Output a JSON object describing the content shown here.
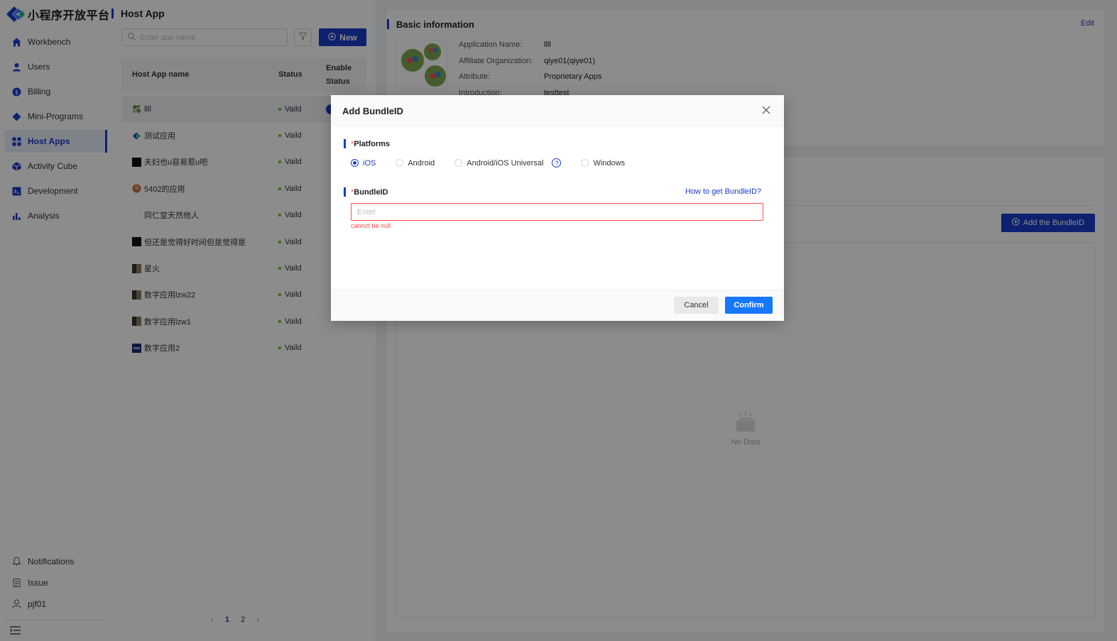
{
  "brand": {
    "name": "小程序开放平台",
    "accent": "#1a3cc9"
  },
  "sidebar": {
    "items": [
      {
        "label": "Workbench",
        "icon": "home-icon"
      },
      {
        "label": "Users",
        "icon": "user-icon"
      },
      {
        "label": "Billing",
        "icon": "billing-icon"
      },
      {
        "label": "Mini-Programs",
        "icon": "diamond-icon"
      },
      {
        "label": "Host Apps",
        "icon": "grid-icon",
        "active": true
      },
      {
        "label": "Activity Cube",
        "icon": "cube-icon"
      },
      {
        "label": "Development",
        "icon": "terminal-icon"
      },
      {
        "label": "Analysis",
        "icon": "bar-chart-icon"
      }
    ],
    "bottom": [
      {
        "label": "Notifications",
        "icon": "bell-icon"
      },
      {
        "label": "Issue",
        "icon": "clipboard-icon"
      },
      {
        "label": "pjf01",
        "icon": "avatar-icon"
      }
    ]
  },
  "list": {
    "title": "Host App",
    "search_placeholder": "Enter app name",
    "new_label": "New",
    "columns": {
      "name": "Host App name",
      "status": "Status",
      "enable_1": "Enable",
      "enable_2": "Status"
    },
    "rows": [
      {
        "name": "llll",
        "status": "Vaild"
      },
      {
        "name": "测试应用",
        "status": "Vaild"
      },
      {
        "name": "夫妇也u容易惹u吧",
        "status": "Vaild"
      },
      {
        "name": "5402的应用",
        "status": "Vaild"
      },
      {
        "name": "同仁堂天然他人",
        "status": "Vaild"
      },
      {
        "name": "但还是觉得好时间但是觉得是",
        "status": "Vaild"
      },
      {
        "name": "星火",
        "status": "Vaild"
      },
      {
        "name": "数字应用lzw22",
        "status": "Vaild"
      },
      {
        "name": "数字应用lzw1",
        "status": "Vaild"
      },
      {
        "name": "数字应用2",
        "status": "Vaild"
      }
    ],
    "pager": {
      "prev": "‹",
      "p1": "1",
      "p2": "2",
      "next": "›"
    }
  },
  "detail": {
    "section_title": "Basic information",
    "edit_label": "Edit",
    "fields": [
      {
        "key": "Application Name:",
        "value": "llll"
      },
      {
        "key": "Affiliate Organization:",
        "value": "qiye01(qiye01)"
      },
      {
        "key": "Attribute:",
        "value": "Proprietary Apps"
      },
      {
        "key": "Introduction:",
        "value": "testtest"
      }
    ],
    "add_bundle_label": "Add the BundleID",
    "no_data": "No Data"
  },
  "modal": {
    "title": "Add BundleID",
    "platforms_label": "Platforms",
    "platforms": [
      "iOS",
      "Android",
      "Android/iOS Universal",
      "Windows"
    ],
    "selected_platform": "iOS",
    "help_glyph": "?",
    "bundle_label": "BundleID",
    "how_link": "How to get BundleID?",
    "bundle_placeholder": "Enter",
    "error": "cannot be null",
    "cancel": "Cancel",
    "confirm": "Confirm",
    "required_mark": "*"
  }
}
